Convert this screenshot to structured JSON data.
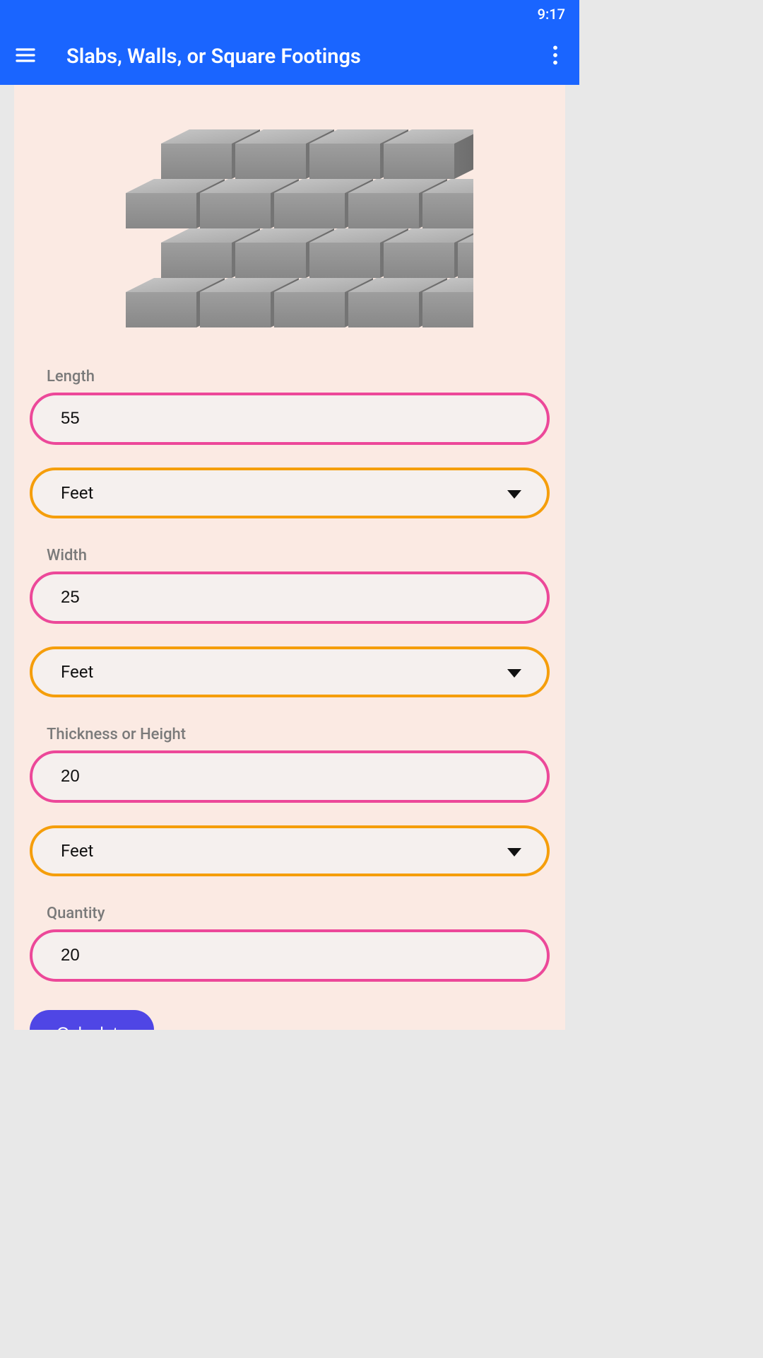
{
  "statusbar": {
    "time": "9:17"
  },
  "appbar": {
    "title": "Slabs, Walls, or Square Footings"
  },
  "form": {
    "length": {
      "label": "Length",
      "value": "55",
      "unit": "Feet"
    },
    "width": {
      "label": "Width",
      "value": "25",
      "unit": "Feet"
    },
    "thickness": {
      "label": "Thickness or Height",
      "value": "20",
      "unit": "Feet"
    },
    "quantity": {
      "label": "Quantity",
      "value": "20"
    },
    "calculate": "Calculate"
  }
}
